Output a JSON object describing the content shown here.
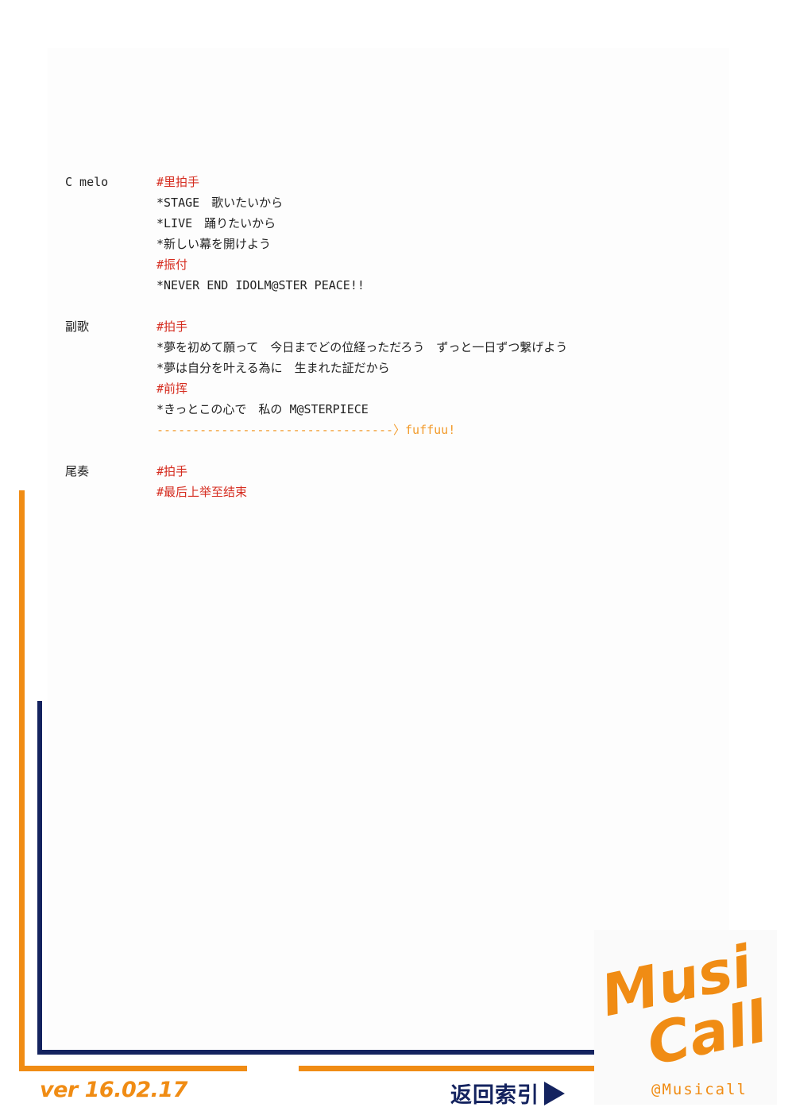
{
  "sections": [
    {
      "label": "C melo",
      "lines": [
        {
          "text": "#里拍手",
          "color": "red"
        },
        {
          "text": "*STAGE　歌いたいから",
          "color": "black"
        },
        {
          "text": "*LIVE　踊りたいから",
          "color": "black"
        },
        {
          "text": "*新しい幕を開けよう",
          "color": "black"
        },
        {
          "text": "#振付",
          "color": "red"
        },
        {
          "text": "*NEVER END IDOLM@STER PEACE!!",
          "color": "black"
        }
      ]
    },
    {
      "label": "副歌",
      "lines": [
        {
          "text": "#拍手",
          "color": "red"
        },
        {
          "text": "*夢を初めて願って　今日までどの位経っただろう　ずっと一日ずつ繋げよう",
          "color": "black"
        },
        {
          "text": "*夢は自分を叶える為に　生まれた証だから",
          "color": "black"
        },
        {
          "text": "#前挥",
          "color": "red"
        },
        {
          "text": "*きっとこの心で　私の M@STERPIECE",
          "color": "black"
        },
        {
          "text": "---------------------------------〉fuffuu!",
          "color": "orange"
        }
      ]
    },
    {
      "label": "尾奏",
      "lines": [
        {
          "text": "#拍手",
          "color": "red"
        },
        {
          "text": "#最后上举至结束",
          "color": "red"
        }
      ]
    }
  ],
  "footer": {
    "version": "ver 16.02.17",
    "back_label": "返回索引",
    "logo_top": "Musi",
    "logo_bottom": "Call",
    "handle": "@Musicall"
  },
  "colors": {
    "red": "#d52b1e",
    "orange": "#f08c14",
    "navy": "#14235f"
  },
  "icons": {
    "back_arrow": "triangle-right-icon",
    "logo": "musicall-logo"
  }
}
